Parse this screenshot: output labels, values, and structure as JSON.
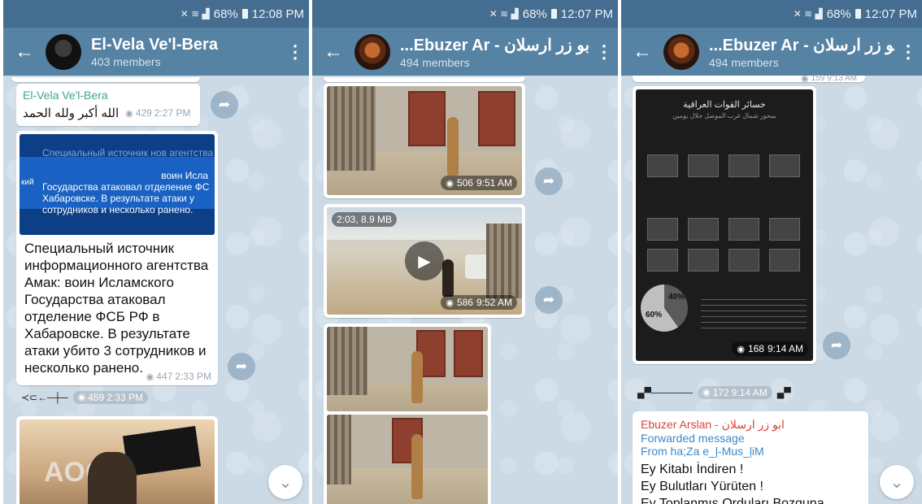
{
  "status_bars": [
    {
      "battery": "68%",
      "time": "12:08 PM"
    },
    {
      "battery": "68%",
      "time": "12:07 PM"
    },
    {
      "battery": "68%",
      "time": "12:07 PM"
    }
  ],
  "screen1": {
    "chat_title": "El-Vela Ve'l-Bera",
    "members": "403 members",
    "msg1": {
      "sender": "El-Vela Ve'l-Bera",
      "text": "الله أكبر ولله الحمد",
      "views": "429",
      "time": "2:27 PM"
    },
    "msg2": {
      "banner_ghost": "Специальный источник нов агентства Амак:",
      "banner_line1": "воин Исла",
      "banner_line2": "Государства атаковал отделение ФС",
      "banner_line3": "Хабаровске. В результате атаки у",
      "banner_line4": "сотрудников и несколько ранено.",
      "banner_side": "кий",
      "text": "Специальный источник информационного агентства Амак: воин Исламского Государства атаковал отделение ФСБ РФ в Хабаровске. В результате атаки убито 3 сотрудников и несколько ранено.",
      "views": "447",
      "time": "2:33 PM"
    },
    "strip": {
      "views": "459",
      "time": "2:33 PM"
    },
    "photo_logo": "AOG"
  },
  "screen2": {
    "chat_title": "...Ebuzer Ar - ابو زر ارسلان",
    "members": "494 members",
    "photo1": {
      "views": "506",
      "time": "9:51 AM"
    },
    "video": {
      "info": "2:03, 8.9 MB",
      "views": "586",
      "time": "9:52 AM"
    }
  },
  "screen3": {
    "chat_title": "...Ebuzer Ar - ابو زر ارسلان",
    "members": "494 members",
    "top_meta": {
      "views": "159",
      "time": "9:13 AM"
    },
    "infographic": {
      "title": "خسائر القوات العراقية",
      "subtitle": "بمحور شمال غرب الموصل خلال يومين",
      "pie_label": "60%",
      "pie_label2": "40%",
      "views": "168",
      "time": "9:14 AM"
    },
    "strip": {
      "views": "172",
      "time": "9:14 AM"
    },
    "forwarded": {
      "sender": "Ebuzer Arslan - ابو زر ارسلان",
      "label": "Forwarded message",
      "from": "From ha;Za e_ļ-Mus_ļiM",
      "lines": [
        "Ey Kitabı İndiren !",
        "Ey Bulutları Yürüten !",
        "Ey Toplanmış Orduları Bozguna"
      ]
    }
  },
  "icons": {
    "back": "arrow-left-icon",
    "menu": "more-vertical-icon",
    "share": "share-icon",
    "views": "eye-icon",
    "play": "play-icon",
    "scroll": "chevron-down-icon"
  }
}
